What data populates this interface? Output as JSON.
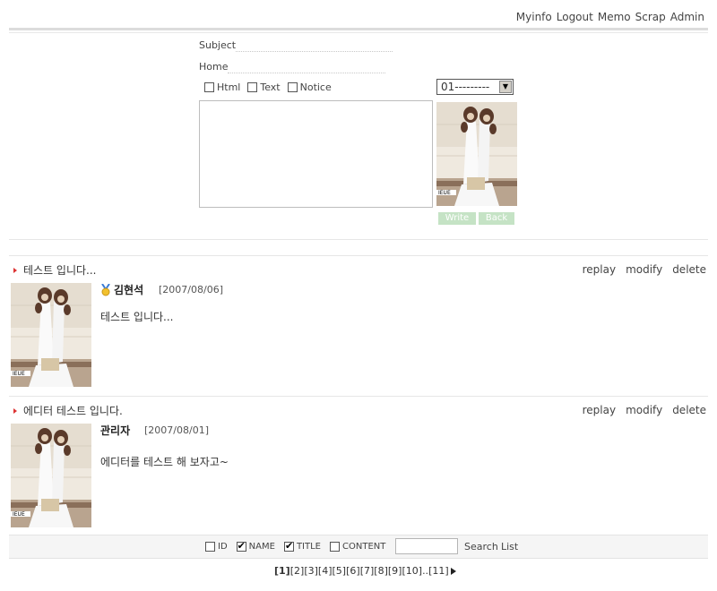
{
  "topnav": {
    "items": [
      "Myinfo",
      "Logout",
      "Memo",
      "Scrap",
      "Admin"
    ]
  },
  "form": {
    "subject_label": "Subject",
    "subject_value": "",
    "home_label": "Home",
    "home_value": "",
    "options": [
      {
        "label": "Html",
        "checked": false
      },
      {
        "label": "Text",
        "checked": false
      },
      {
        "label": "Notice",
        "checked": false
      }
    ],
    "icon_select_value": "01---------",
    "write_label": "Write",
    "back_label": "Back",
    "button_color": "#c5e3c5"
  },
  "posts": [
    {
      "title": "테스트 입니다...",
      "author": "김현석",
      "has_medal": true,
      "date": "[2007/08/06]",
      "body": "테스트 입니다...",
      "actions": [
        "replay",
        "modify",
        "delete"
      ]
    },
    {
      "title": "에디터 테스트 입니다.",
      "author": "관리자",
      "has_medal": false,
      "date": "[2007/08/01]",
      "body": "에디터를 테스트 해 보자고~",
      "actions": [
        "replay",
        "modify",
        "delete"
      ]
    }
  ],
  "photo_caption": "IEUE",
  "search": {
    "filters": [
      {
        "label": "ID",
        "checked": false
      },
      {
        "label": "NAME",
        "checked": true
      },
      {
        "label": "TITLE",
        "checked": true
      },
      {
        "label": "CONTENT",
        "checked": false
      }
    ],
    "query": "",
    "search_label": "Search",
    "list_label": "List"
  },
  "pagination": {
    "current": "[1]",
    "pages": [
      "[2]",
      "[3]",
      "[4]",
      "[5]",
      "[6]",
      "[7]",
      "[8]",
      "[9]",
      "[10]"
    ],
    "ellipsis": "..",
    "last": "[11]"
  },
  "colors": {
    "accent_triangle": "#dd3333",
    "border": "#e6e6e6"
  }
}
